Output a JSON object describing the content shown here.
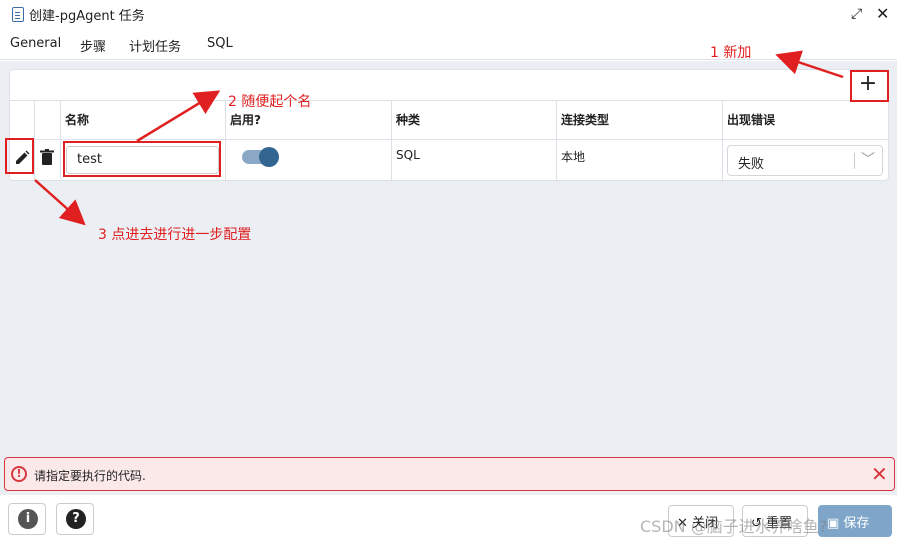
{
  "window": {
    "title": "创建-pgAgent 任务",
    "expand_glyph": "⤢",
    "close_glyph": "✕"
  },
  "tabs": [
    {
      "label": "General"
    },
    {
      "label": "步骤"
    },
    {
      "label": "计划任务"
    },
    {
      "label": "SQL"
    }
  ],
  "grid": {
    "add_glyph": "+",
    "columns": [
      "名称",
      "启用?",
      "种类",
      "连接类型",
      "出现错误"
    ],
    "row": {
      "name": "test",
      "enabled": true,
      "kind": "SQL",
      "connection_type": "本地",
      "on_error": "失败"
    }
  },
  "annotations": {
    "step1": "1 新加",
    "step2": "2 随便起个名",
    "step3": "3 点进去进行进一步配置",
    "color": "#e02020"
  },
  "error": {
    "message": "请指定要执行的代码.",
    "icon_glyph": "!",
    "close_glyph": "✕"
  },
  "footer": {
    "info_glyph": "i",
    "help_glyph": "?",
    "close_label": "关闭",
    "reset_label": "重置",
    "save_label": "保存",
    "watermark": "CSDN @脑子进水养啥鱼?"
  },
  "colors": {
    "accent": "#326690",
    "error": "#d9363e"
  }
}
